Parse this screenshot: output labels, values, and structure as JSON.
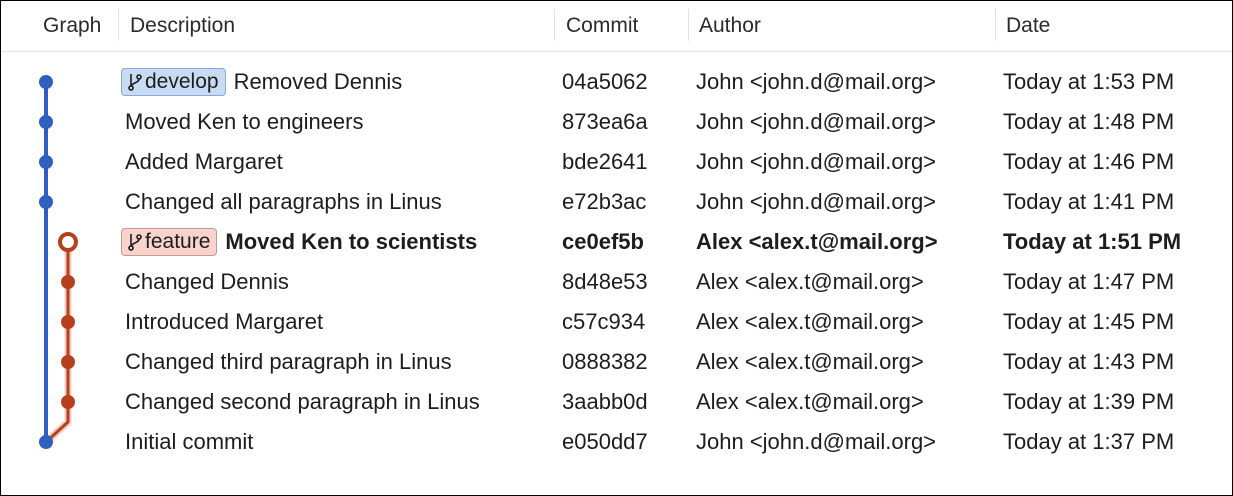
{
  "columns": {
    "graph": "Graph",
    "description": "Description",
    "commit": "Commit",
    "author": "Author",
    "date": "Date"
  },
  "branches": {
    "develop": {
      "label": "develop",
      "color": "#2f5fbf",
      "badge_bg": "#c9daf3"
    },
    "feature": {
      "label": "feature",
      "color": "#b5401e",
      "badge_bg": "#f7d3cb"
    }
  },
  "commits": [
    {
      "description": "Removed Dennis",
      "branch_badge": "develop",
      "lane": "develop",
      "hash": "04a5062",
      "author": "John <john.d@mail.org>",
      "date": "Today at 1:53 PM",
      "current": false
    },
    {
      "description": "Moved Ken to engineers",
      "lane": "develop",
      "hash": "873ea6a",
      "author": "John <john.d@mail.org>",
      "date": "Today at 1:48 PM",
      "current": false
    },
    {
      "description": "Added Margaret",
      "lane": "develop",
      "hash": "bde2641",
      "author": "John <john.d@mail.org>",
      "date": "Today at 1:46 PM",
      "current": false
    },
    {
      "description": "Changed all paragraphs in Linus",
      "lane": "develop",
      "hash": "e72b3ac",
      "author": "John <john.d@mail.org>",
      "date": "Today at 1:41 PM",
      "current": false
    },
    {
      "description": "Moved Ken to scientists",
      "branch_badge": "feature",
      "lane": "feature",
      "hash": "ce0ef5b",
      "author": "Alex <alex.t@mail.org>",
      "date": "Today at 1:51 PM",
      "current": true
    },
    {
      "description": "Changed Dennis",
      "lane": "feature",
      "hash": "8d48e53",
      "author": "Alex <alex.t@mail.org>",
      "date": "Today at 1:47 PM",
      "current": false
    },
    {
      "description": "Introduced Margaret",
      "lane": "feature",
      "hash": "c57c934",
      "author": "Alex <alex.t@mail.org>",
      "date": "Today at 1:45 PM",
      "current": false
    },
    {
      "description": "Changed third paragraph in Linus",
      "lane": "feature",
      "hash": "0888382",
      "author": "Alex <alex.t@mail.org>",
      "date": "Today at 1:43 PM",
      "current": false
    },
    {
      "description": "Changed second paragraph in Linus",
      "lane": "feature",
      "hash": "3aabb0d",
      "author": "Alex <alex.t@mail.org>",
      "date": "Today at 1:39 PM",
      "current": false
    },
    {
      "description": "Initial commit",
      "lane": "develop",
      "hash": "e050dd7",
      "author": "John <john.d@mail.org>",
      "date": "Today at 1:37 PM",
      "current": false
    }
  ]
}
